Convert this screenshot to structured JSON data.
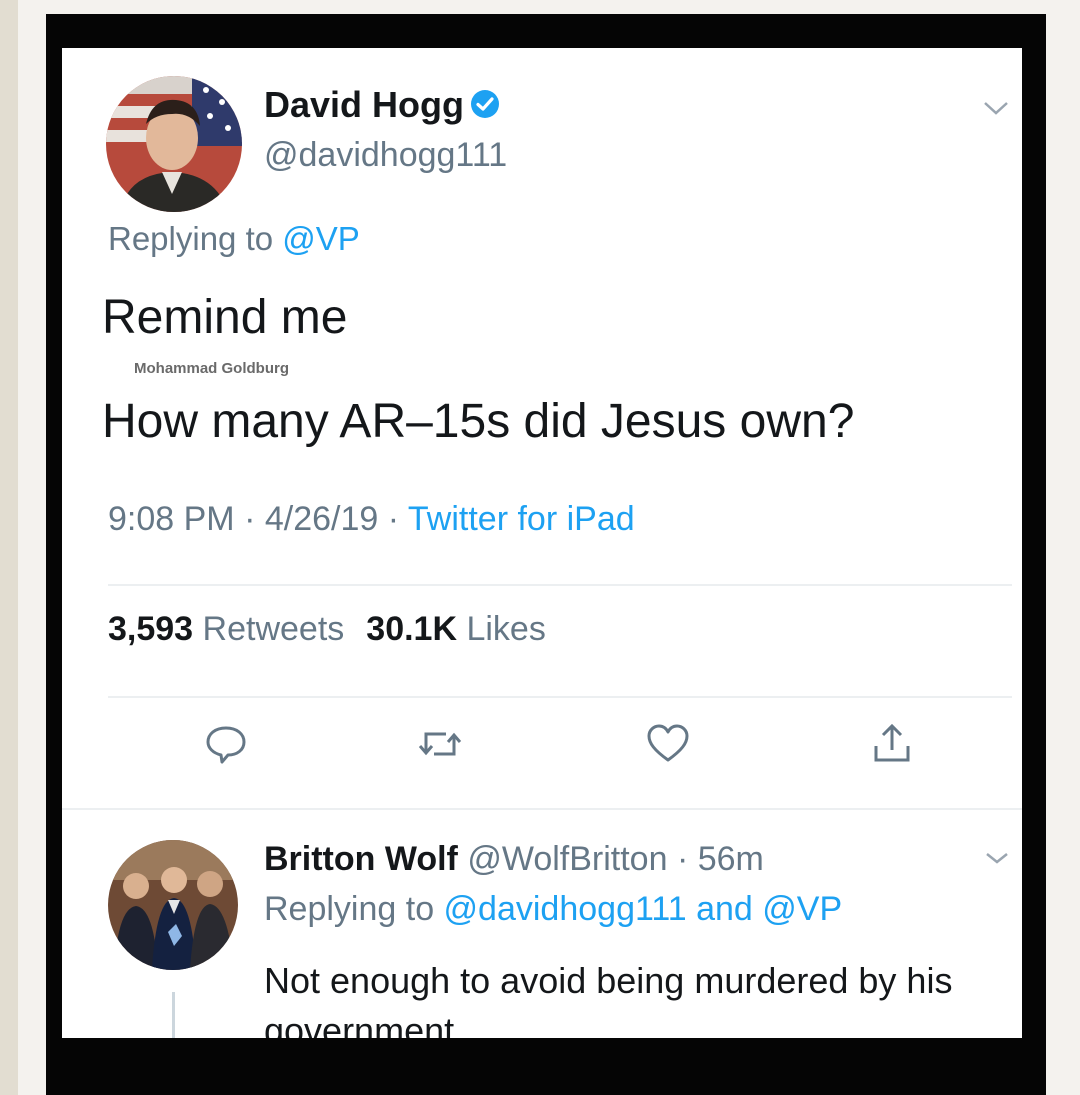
{
  "tweet": {
    "author_name": "David Hogg",
    "author_handle": "@davidhogg111",
    "replying_prefix": "Replying to ",
    "replying_to": "@VP",
    "line1": "Remind me",
    "watermark": "Mohammad Goldburg",
    "line2": "How many AR–15s did Jesus own?",
    "time": "9:08 PM",
    "date": "4/26/19",
    "separator": " · ",
    "source": "Twitter for iPad",
    "retweets_count": "3,593",
    "retweets_label": "Retweets",
    "likes_count": "30.1K",
    "likes_label": "Likes",
    "actions": [
      "reply-icon",
      "retweet-icon",
      "like-icon",
      "share-icon"
    ]
  },
  "reply": {
    "author_name": "Britton Wolf",
    "author_handle": "@WolfBritton",
    "separator": " · ",
    "age": "56m",
    "replying_prefix": "Replying to ",
    "replying_to_1": "@davidhogg111",
    "replying_and": " and ",
    "replying_to_2": "@VP",
    "text": "Not enough to avoid being murdered by his government."
  },
  "colors": {
    "link": "#1da1f2",
    "muted": "#657786",
    "text": "#14171a",
    "frame": "#050505",
    "verified": "#1da1f2"
  }
}
